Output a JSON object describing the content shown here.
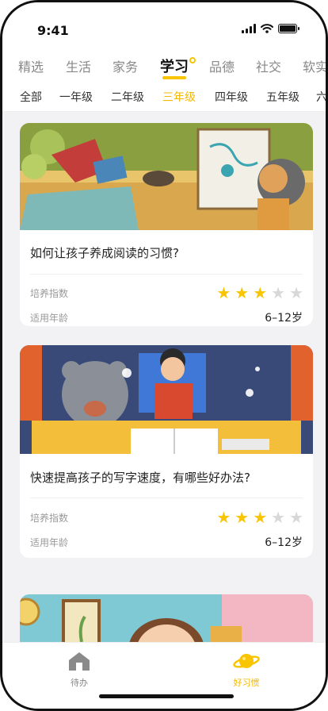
{
  "status": {
    "time": "9:41"
  },
  "categories": [
    "精选",
    "生活",
    "家务",
    "学习",
    "品德",
    "社交",
    "软实力"
  ],
  "active_category": "学习",
  "grades": [
    "全部",
    "一年级",
    "二年级",
    "三年级",
    "四年级",
    "五年级",
    "六年级"
  ],
  "active_grade": "三年级",
  "cards": [
    {
      "title": "如何让孩子养成阅读的习惯?",
      "index_label": "培养指数",
      "rating": 3,
      "rating_max": 5,
      "age_label": "适用年龄",
      "age_value": "6–12岁"
    },
    {
      "title": "快速提高孩子的写字速度，有哪些好办法?",
      "index_label": "培养指数",
      "rating": 3,
      "rating_max": 5,
      "age_label": "适用年龄",
      "age_value": "6–12岁"
    }
  ],
  "tabbar": {
    "todo_label": "待办",
    "todo_icon": "house-icon",
    "habit_label": "好习惯",
    "habit_icon": "planet-icon"
  },
  "colors": {
    "accent": "#f9c500",
    "accent_text": "#f5b800"
  }
}
